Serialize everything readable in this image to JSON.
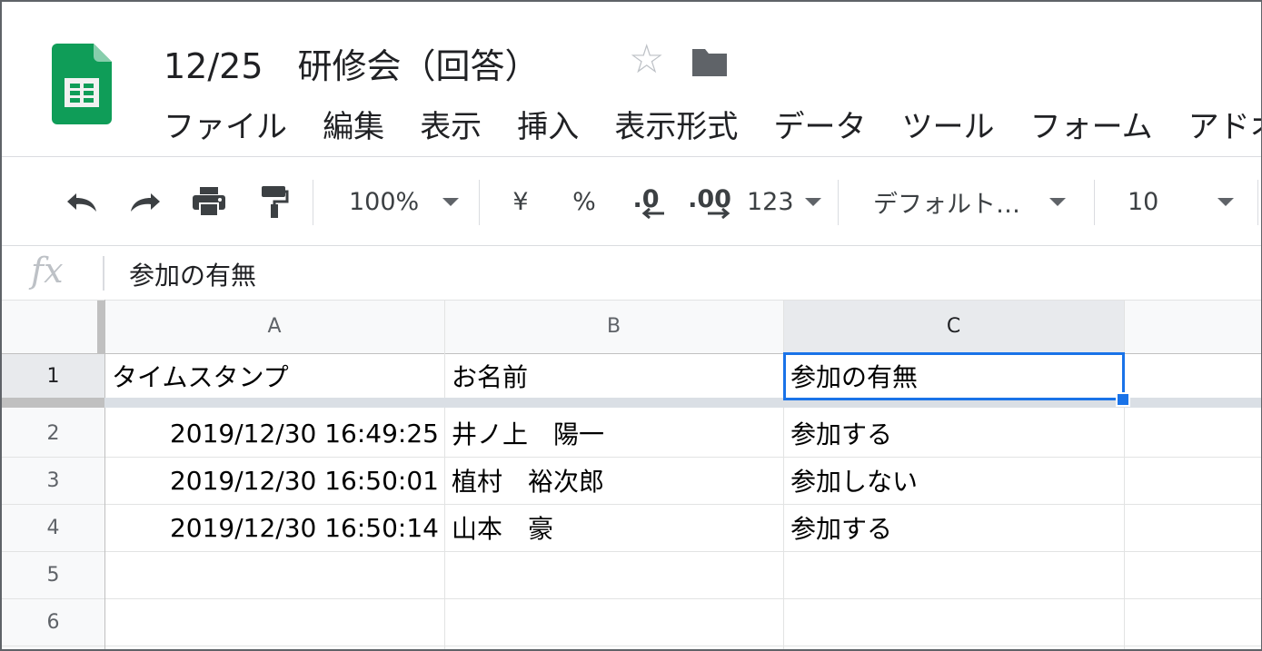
{
  "document": {
    "title": "12/25　研修会（回答）"
  },
  "menu": [
    "ファイル",
    "編集",
    "表示",
    "挿入",
    "表示形式",
    "データ",
    "ツール",
    "フォーム",
    "アドオ"
  ],
  "toolbar": {
    "zoom": "100%",
    "currency": "¥",
    "percent": "%",
    "decrease_decimal": ".0",
    "increase_decimal": ".00",
    "number_format": "123",
    "font": "デフォルト…",
    "font_size": "10"
  },
  "formula_bar": {
    "fx_label": "fx",
    "value": "参加の有無"
  },
  "sheet": {
    "columns": [
      "A",
      "B",
      "C"
    ],
    "row_numbers": [
      "1",
      "2",
      "3",
      "4",
      "5",
      "6"
    ],
    "rows": [
      [
        "タイムスタンプ",
        "お名前",
        "参加の有無"
      ],
      [
        "2019/12/30 16:49:25",
        "井ノ上　陽一",
        "参加する"
      ],
      [
        "2019/12/30 16:50:01",
        "植村　裕次郎",
        "参加しない"
      ],
      [
        "2019/12/30 16:50:14",
        "山本　豪",
        "参加する"
      ]
    ],
    "selected_cell": "C1"
  },
  "colors": {
    "accent": "#1a73e8",
    "sheets_green": "#0f9d58"
  }
}
